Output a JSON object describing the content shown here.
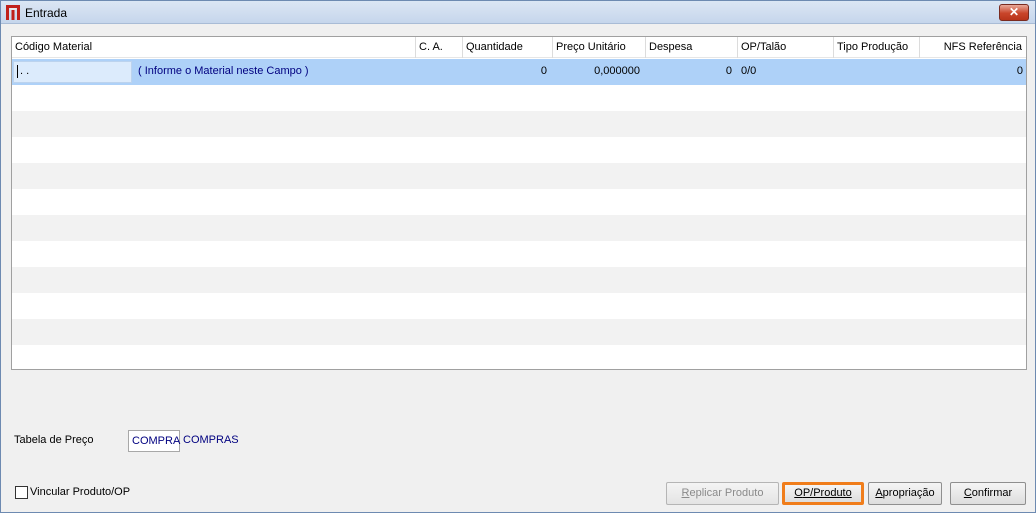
{
  "window": {
    "title": "Entrada",
    "close_label": "✕"
  },
  "grid": {
    "columns": [
      {
        "label": "Código Material"
      },
      {
        "label": "C. A."
      },
      {
        "label": "Quantidade"
      },
      {
        "label": "Preço Unitário"
      },
      {
        "label": "Despesa"
      },
      {
        "label": "OP/Talão"
      },
      {
        "label": "Tipo Produção"
      },
      {
        "label": "NFS Referência"
      }
    ],
    "rows": [
      {
        "code": ". .",
        "description": "( Informe o Material neste Campo )",
        "quantity": "0",
        "unit_price": "0,000000",
        "expense": "0",
        "op_talao": "0/0",
        "tipo_producao": "",
        "nfs_referencia": "0"
      }
    ]
  },
  "price_table": {
    "label": "Tabela de Preço",
    "value": "COMPRA",
    "description": "COMPRAS"
  },
  "link_product_op": {
    "label": "Vincular Produto/OP",
    "checked": false
  },
  "buttons": {
    "replicate_first": "R",
    "replicate_rest": "eplicar Produto",
    "op_product_first": "O",
    "op_product_rest": "P/Produto",
    "appropriation_first": "A",
    "appropriation_rest": "propriação",
    "confirm_first": "C",
    "confirm_rest": "onfirmar"
  },
  "colors": {
    "selected_row": "#aed1f8",
    "focus_outline": "#f07d1b",
    "value_text": "#000080",
    "close_button": "#c9452a"
  }
}
